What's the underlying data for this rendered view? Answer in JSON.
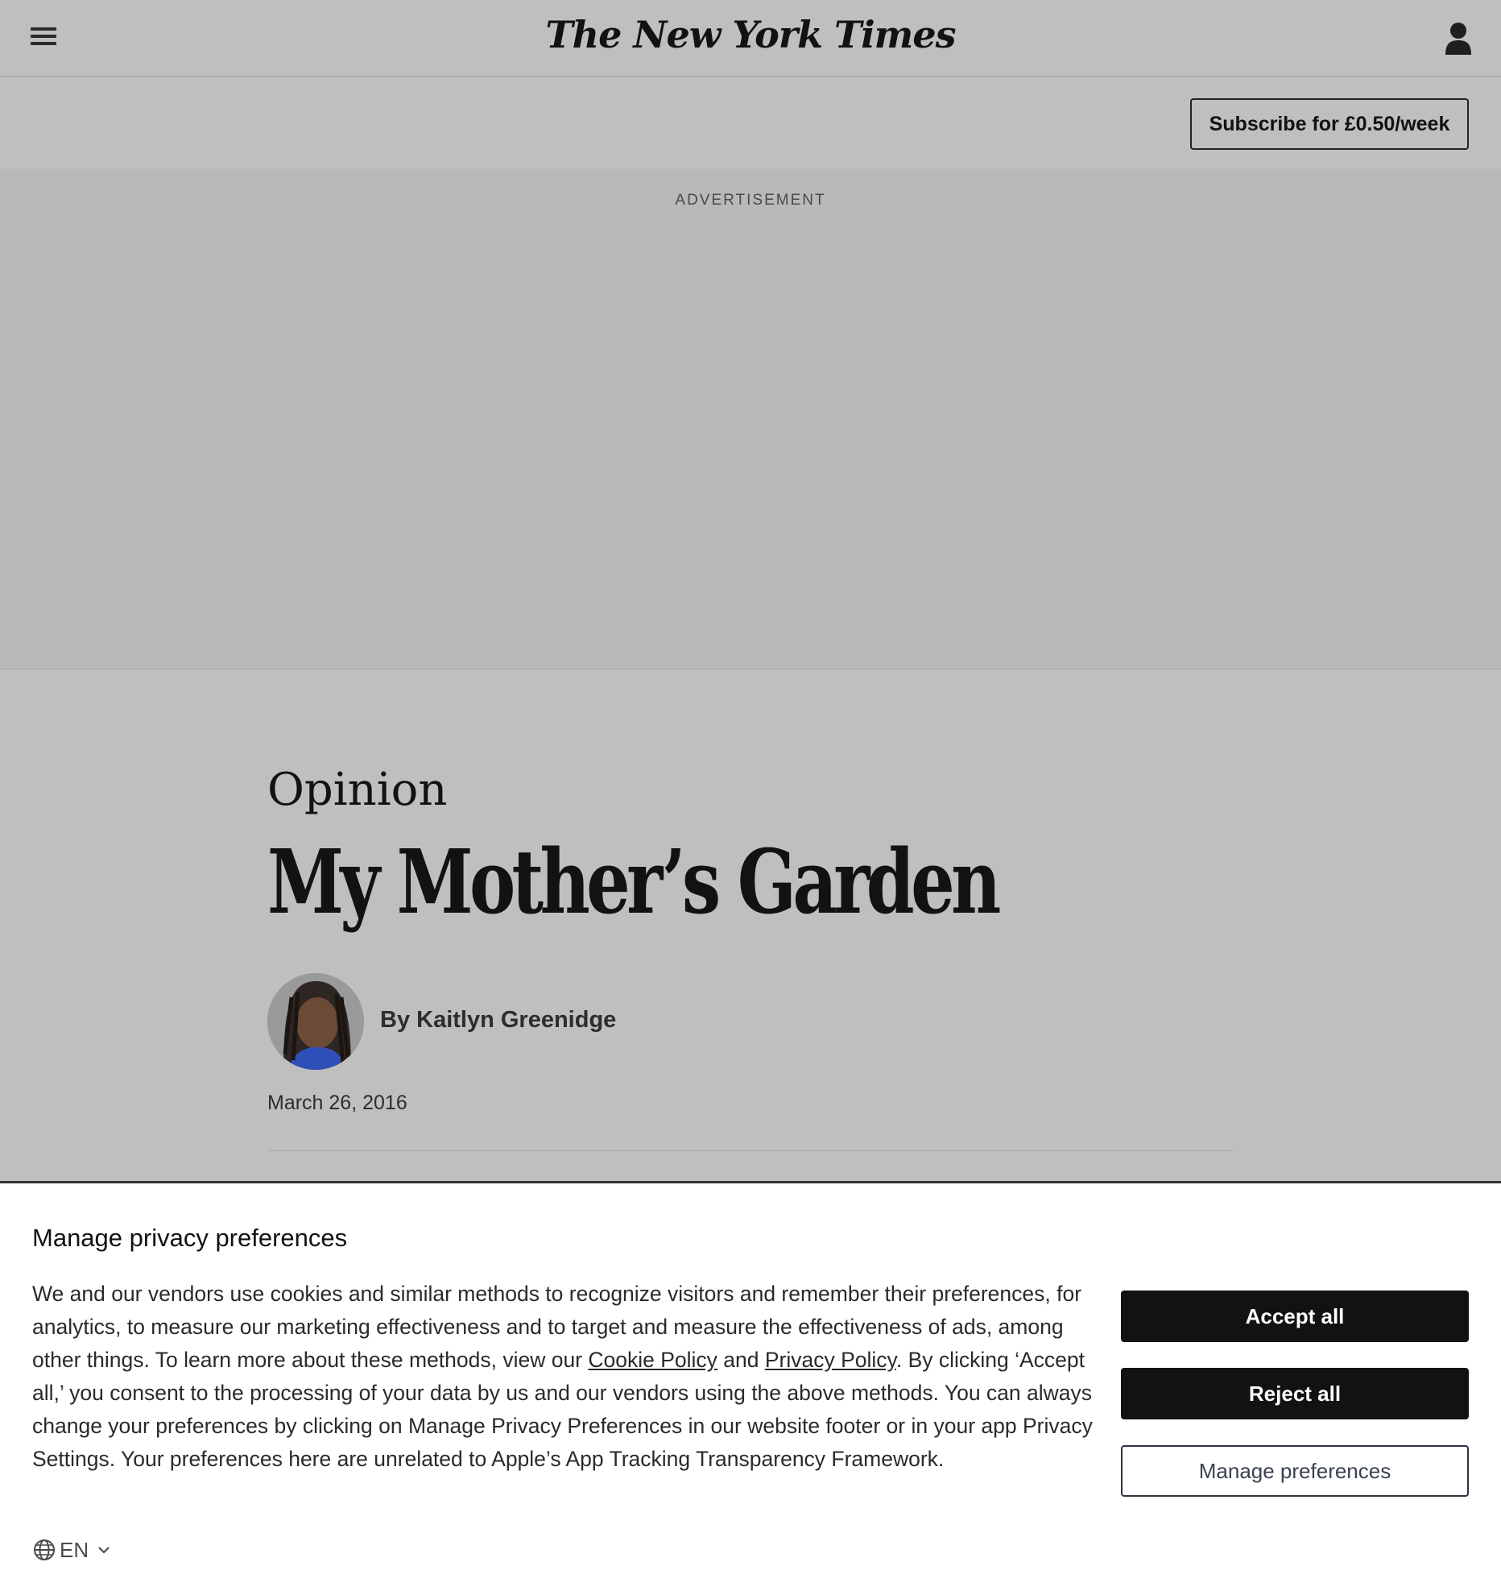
{
  "header": {
    "logo_text": "The New York Times",
    "menu_icon": "hamburger-menu-icon",
    "user_icon": "user-account-icon",
    "subscribe_label": "Subscribe for £0.50/week"
  },
  "ad": {
    "label": "ADVERTISEMENT"
  },
  "article": {
    "kicker": "Opinion",
    "headline": "My Mother’s Garden",
    "byline": "By Kaitlyn Greenidge",
    "date": "March 26, 2016"
  },
  "consent": {
    "title": "Manage privacy preferences",
    "body_part1": "We and our vendors use cookies and similar methods to recognize visitors and remember their preferences, for analytics, to measure our marketing effectiveness and to target and measure the effectiveness of ads, among other things. To learn more about these methods, view our ",
    "cookie_link": "Cookie Policy",
    "body_and": " and ",
    "privacy_link": "Privacy Policy",
    "body_part2": ". By clicking ‘Accept all,’ you consent to the processing of your data by us and our vendors using the above methods. You can always change your preferences by clicking on Manage Privacy Preferences in our website footer or in your app Privacy Settings. Your preferences here are unrelated to Apple’s App Tracking Transparency Framework.",
    "accept_label": "Accept all",
    "reject_label": "Reject all",
    "manage_label": "Manage preferences",
    "language": "EN"
  }
}
